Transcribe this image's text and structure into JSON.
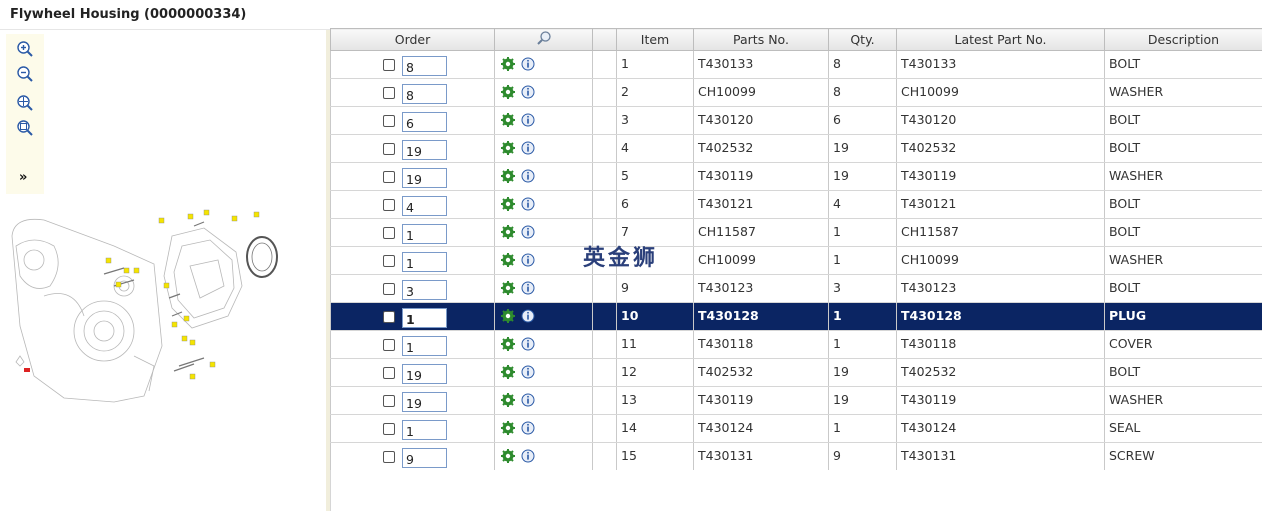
{
  "title": "Flywheel Housing (0000000334)",
  "toolbar": {
    "tools": [
      "zoom-in-icon",
      "zoom-out-icon",
      "zoom-fit-icon",
      "zoom-reset-icon"
    ],
    "expand_label": "»"
  },
  "columns": {
    "order": "Order",
    "search": "",
    "blank": "",
    "item": "Item",
    "parts_no": "Parts No.",
    "qty": "Qty.",
    "latest": "Latest Part No.",
    "description": "Description"
  },
  "rows": [
    {
      "order": "8",
      "item": "1",
      "parts_no": "T430133",
      "qty": "8",
      "latest": "T430133",
      "description": "BOLT"
    },
    {
      "order": "8",
      "item": "2",
      "parts_no": "CH10099",
      "qty": "8",
      "latest": "CH10099",
      "description": "WASHER"
    },
    {
      "order": "6",
      "item": "3",
      "parts_no": "T430120",
      "qty": "6",
      "latest": "T430120",
      "description": "BOLT"
    },
    {
      "order": "19",
      "item": "4",
      "parts_no": "T402532",
      "qty": "19",
      "latest": "T402532",
      "description": "BOLT"
    },
    {
      "order": "19",
      "item": "5",
      "parts_no": "T430119",
      "qty": "19",
      "latest": "T430119",
      "description": "WASHER"
    },
    {
      "order": "4",
      "item": "6",
      "parts_no": "T430121",
      "qty": "4",
      "latest": "T430121",
      "description": "BOLT"
    },
    {
      "order": "1",
      "item": "7",
      "parts_no": "CH11587",
      "qty": "1",
      "latest": "CH11587",
      "description": "BOLT"
    },
    {
      "order": "1",
      "item": "",
      "parts_no": "CH10099",
      "qty": "1",
      "latest": "CH10099",
      "description": "WASHER"
    },
    {
      "order": "3",
      "item": "9",
      "parts_no": "T430123",
      "qty": "3",
      "latest": "T430123",
      "description": "BOLT"
    },
    {
      "order": "1",
      "item": "10",
      "parts_no": "T430128",
      "qty": "1",
      "latest": "T430128",
      "description": "PLUG"
    },
    {
      "order": "1",
      "item": "11",
      "parts_no": "T430118",
      "qty": "1",
      "latest": "T430118",
      "description": "COVER"
    },
    {
      "order": "19",
      "item": "12",
      "parts_no": "T402532",
      "qty": "19",
      "latest": "T402532",
      "description": "BOLT"
    },
    {
      "order": "19",
      "item": "13",
      "parts_no": "T430119",
      "qty": "19",
      "latest": "T430119",
      "description": "WASHER"
    },
    {
      "order": "1",
      "item": "14",
      "parts_no": "T430124",
      "qty": "1",
      "latest": "T430124",
      "description": "SEAL"
    },
    {
      "order": "9",
      "item": "15",
      "parts_no": "T430131",
      "qty": "9",
      "latest": "T430131",
      "description": "SCREW"
    }
  ],
  "selected_row_index": 9,
  "watermark": "英金狮",
  "colors": {
    "selected_row": "#0b2563",
    "gear": "#2e8b2e",
    "info": "#2b5aa6",
    "header": "#e9e9e9"
  }
}
